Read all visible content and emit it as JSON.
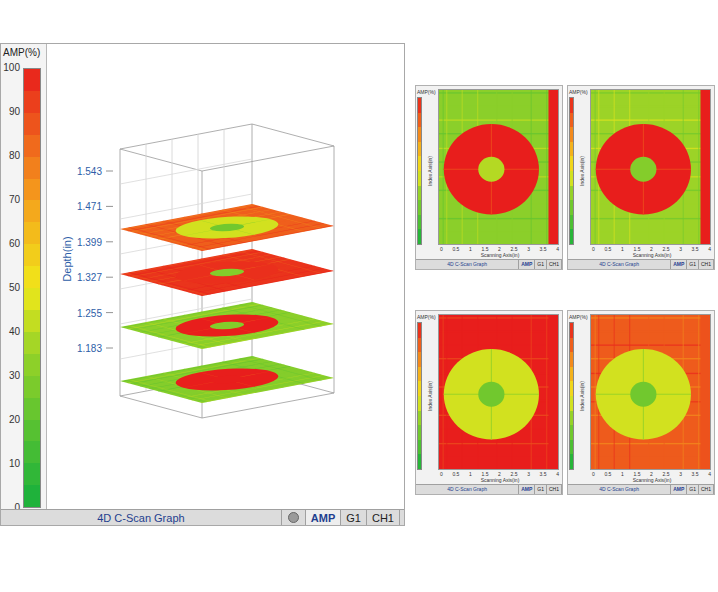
{
  "legend": {
    "title": "AMP(%)",
    "ticks": [
      "100",
      "90",
      "80",
      "70",
      "60",
      "50",
      "40",
      "30",
      "20",
      "10",
      "0"
    ]
  },
  "chart": {
    "axis_title": "Depth(in)",
    "depth_ticks": [
      "1.543",
      "1.471",
      "1.399",
      "1.327",
      "1.255",
      "1.183"
    ],
    "layers": [
      {
        "background_amp": 85,
        "disk_amp": 45,
        "core_amp": 25
      },
      {
        "background_amp": 95,
        "disk_amp": 96,
        "core_amp": 30
      },
      {
        "background_amp": 32,
        "disk_amp": 100,
        "core_amp": 30
      },
      {
        "background_amp": 30,
        "disk_amp": 100,
        "core_amp": 100
      }
    ]
  },
  "status_bar": {
    "title": "4D C-Scan Graph",
    "tabs": [
      {
        "label": "AMP",
        "selected": true
      },
      {
        "label": "G1",
        "selected": false
      },
      {
        "label": "CH1",
        "selected": false
      }
    ]
  },
  "thumbnails": [
    {
      "legend_title": "AMP(%)",
      "y_axis_title": "Index Axis(in)",
      "x_axis_title": "Scanning Axis(in)",
      "x_ticks": [
        "0",
        "0.5",
        "1",
        "1.5",
        "2",
        "2.5",
        "3",
        "3.5",
        "4"
      ],
      "status": "4D C-Scan Graph",
      "tabs": [
        {
          "label": "AMP",
          "selected": true
        },
        {
          "label": "G1",
          "selected": false
        },
        {
          "label": "CH1",
          "selected": false
        }
      ],
      "background_amp": 32,
      "disk_amp": 100,
      "core_amp": 40,
      "edge_amp": 100
    },
    {
      "legend_title": "AMP(%)",
      "y_axis_title": "Index Axis(in)",
      "x_axis_title": "Scanning Axis(in)",
      "x_ticks": [
        "0",
        "0.5",
        "1",
        "1.5",
        "2",
        "2.5",
        "3",
        "3.5",
        "4"
      ],
      "status": "4D C-Scan Graph",
      "tabs": [
        {
          "label": "AMP",
          "selected": true
        },
        {
          "label": "G1",
          "selected": false
        },
        {
          "label": "CH1",
          "selected": false
        }
      ],
      "background_amp": 36,
      "disk_amp": 100,
      "core_amp": 30,
      "edge_amp": 100
    },
    {
      "legend_title": "AMP(%)",
      "y_axis_title": "Index Axis(in)",
      "x_axis_title": "Scanning Axis(in)",
      "x_ticks": [
        "0",
        "0.5",
        "1",
        "1.5",
        "2",
        "2.5",
        "3",
        "3.5",
        "4"
      ],
      "status": "4D C-Scan Graph",
      "tabs": [
        {
          "label": "AMP",
          "selected": true
        },
        {
          "label": "G1",
          "selected": false
        },
        {
          "label": "CH1",
          "selected": false
        }
      ],
      "background_amp": 100,
      "disk_amp": 45,
      "core_amp": 25,
      "edge_amp": 100
    },
    {
      "legend_title": "AMP(%)",
      "y_axis_title": "Index Axis(in)",
      "x_axis_title": "Scanning Axis(in)",
      "x_ticks": [
        "0",
        "0.5",
        "1",
        "1.5",
        "2",
        "2.5",
        "3",
        "3.5",
        "4"
      ],
      "status": "4D C-Scan Graph",
      "tabs": [
        {
          "label": "AMP",
          "selected": true
        },
        {
          "label": "G1",
          "selected": false
        },
        {
          "label": "CH1",
          "selected": false
        }
      ],
      "background_amp": 86,
      "disk_amp": 45,
      "core_amp": 25,
      "edge_amp": 88
    }
  ]
}
